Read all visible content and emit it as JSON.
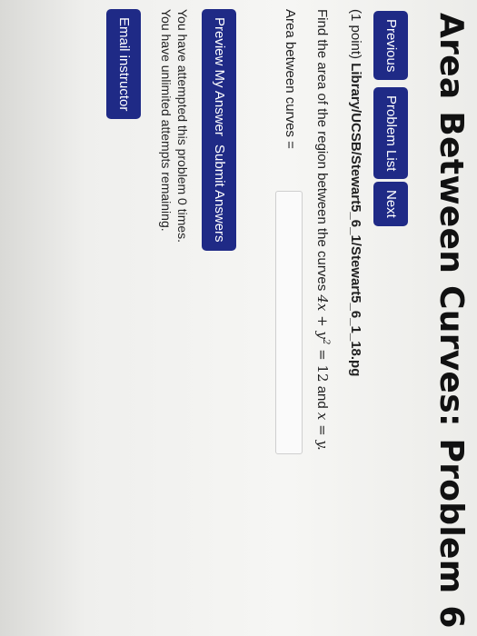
{
  "page": {
    "title": "Area Between Curves: Problem 6"
  },
  "nav": {
    "previous": "Previous",
    "problem_list": "Problem List",
    "next": "Next"
  },
  "problem": {
    "points": "(1 point)",
    "path": "Library/UCSB/Stewart5_6_1/Stewart5_6_1_18.pg",
    "question_prefix": "Find the area of the region between the curves",
    "eq1_lhs": "4x + y",
    "eq1_exp": "2",
    "eq1_rhs": " = 12",
    "and": "and",
    "eq2": "x = y.",
    "answer_label": "Area between curves ="
  },
  "answer": {
    "value": ""
  },
  "form": {
    "preview": "Preview My Answers",
    "submit": "Submit Answers"
  },
  "status": {
    "attempted": "You have attempted this problem 0 times.",
    "remaining": "You have unlimited attempts remaining."
  },
  "footer": {
    "email": "Email instructor"
  },
  "colors": {
    "button_bg": "#1f2a86",
    "button_text": "#ffffff",
    "page_bg": "#f4f4f2"
  }
}
